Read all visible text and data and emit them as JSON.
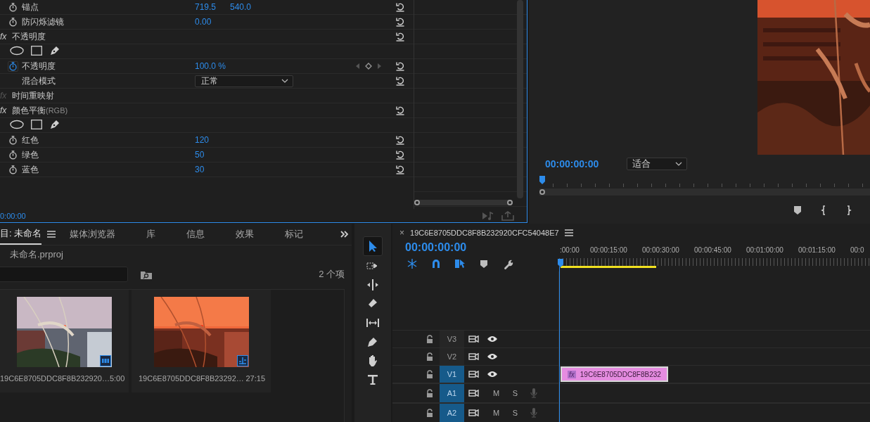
{
  "effect_controls": {
    "rows": [
      {
        "kind": "property",
        "label": "锚点",
        "values": [
          "719.5",
          "540.0"
        ],
        "animated": false,
        "reset": true
      },
      {
        "kind": "property",
        "label": "防闪烁滤镜",
        "values": [
          "0.00"
        ],
        "animated": false,
        "reset": true
      },
      {
        "kind": "effect",
        "fx": "fx",
        "label": "不透明度",
        "enabled": true,
        "reset": true
      },
      {
        "kind": "masks",
        "reset": false
      },
      {
        "kind": "property",
        "label": "不透明度",
        "values": [
          "100.0 %"
        ],
        "animated": true,
        "reset": true
      },
      {
        "kind": "dropdown",
        "label": "混合模式",
        "value": "正常",
        "reset": true
      },
      {
        "kind": "effect",
        "fx": "fx",
        "label": "时间重映射",
        "enabled": false,
        "reset": false
      },
      {
        "kind": "effect",
        "fx": "fx",
        "label": "颜色平衡",
        "suffix": "(RGB)",
        "enabled": true,
        "reset": true
      },
      {
        "kind": "masks",
        "reset": false
      },
      {
        "kind": "property",
        "label": "红色",
        "values": [
          "120"
        ],
        "animated": false,
        "reset": true
      },
      {
        "kind": "property",
        "label": "绿色",
        "values": [
          "50"
        ],
        "animated": false,
        "reset": true
      },
      {
        "kind": "property",
        "label": "蓝色",
        "values": [
          "30"
        ],
        "animated": false,
        "reset": true
      }
    ],
    "timecode": "0:00:00"
  },
  "program_monitor": {
    "timecode": "00:00:00:00",
    "zoom": "适合"
  },
  "project": {
    "tabs": [
      {
        "label": "目: 未命名",
        "selected": true
      },
      {
        "label": "媒体浏览器",
        "selected": false
      },
      {
        "label": "库",
        "selected": false
      },
      {
        "label": "信息",
        "selected": false
      },
      {
        "label": "效果",
        "selected": false
      },
      {
        "label": "标记",
        "selected": false
      }
    ],
    "file": "未命名.prproj",
    "count": "2 个项",
    "items": [
      {
        "name": "19C6E8705DDC8F8B232920…",
        "duration": "5:00",
        "kind": "video"
      },
      {
        "name": "19C6E8705DDC8F8B23292…",
        "duration": "27:15",
        "kind": "sequence"
      }
    ]
  },
  "tools": [
    {
      "kind": "selection",
      "selected": true
    },
    {
      "kind": "track_select",
      "selected": false
    },
    {
      "kind": "ripple",
      "selected": false
    },
    {
      "kind": "razor",
      "selected": false
    },
    {
      "kind": "slip",
      "selected": false
    },
    {
      "kind": "pen",
      "selected": false
    },
    {
      "kind": "hand",
      "selected": false
    },
    {
      "kind": "type",
      "selected": false
    }
  ],
  "timeline": {
    "close": "×",
    "sequence": "19C6E8705DDC8F8B232920CFC54048E7",
    "timecode": "00:00:00:00",
    "toggles": [
      {
        "kind": "nest",
        "on": true
      },
      {
        "kind": "snap",
        "on": true
      },
      {
        "kind": "linked",
        "on": true
      },
      {
        "kind": "marker",
        "on": false
      },
      {
        "kind": "settings",
        "on": false
      }
    ],
    "ruler": [
      ":00:00",
      "00:00:15:00",
      "00:00:30:00",
      "00:00:45:00",
      "00:01:00:00",
      "00:01:15:00",
      "00:0"
    ],
    "tracks": [
      {
        "kind": "video",
        "label": "V3",
        "selected": false
      },
      {
        "kind": "video",
        "label": "V2",
        "selected": false
      },
      {
        "kind": "video",
        "label": "V1",
        "selected": true,
        "clip": {
          "fx": "fx",
          "name": "19C6E8705DDC8F8B232"
        }
      },
      {
        "kind": "audio",
        "label": "A1",
        "selected": true,
        "mute": "M",
        "solo": "S"
      },
      {
        "kind": "audio",
        "label": "A2",
        "selected": true,
        "mute": "M",
        "solo": "S"
      }
    ]
  }
}
